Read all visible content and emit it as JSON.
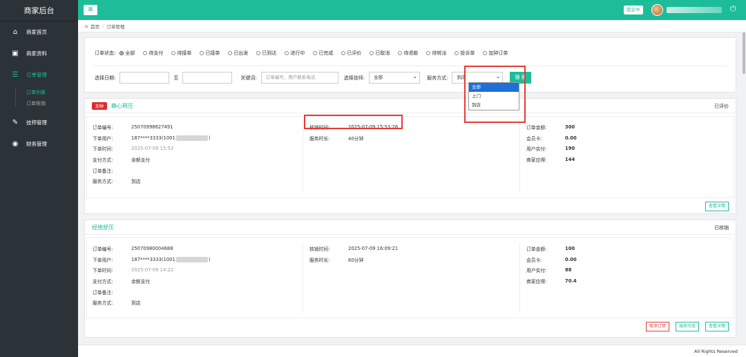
{
  "sidebar": {
    "title": "商家后台",
    "items": [
      {
        "label": "商家首页",
        "icon": "home-icon"
      },
      {
        "label": "商家资料",
        "icon": "profile-icon"
      },
      {
        "label": "订单管理",
        "icon": "order-icon"
      },
      {
        "label": "技师管理",
        "icon": "edit-icon"
      },
      {
        "label": "财务管理",
        "icon": "finance-icon"
      }
    ],
    "subitems": [
      "订单列表",
      "订单核销"
    ]
  },
  "topbar": {
    "menu_icon": "≡",
    "status_label": "营业中",
    "power_icon": "⏻"
  },
  "breadcrumb": {
    "home": "首页",
    "sep": "/",
    "current": "订单管理"
  },
  "filter": {
    "status_label": "订单状态:",
    "statuses": [
      "全部",
      "待支付",
      "待接单",
      "已接单",
      "已出发",
      "已到达",
      "进行中",
      "已完成",
      "已评价",
      "已取消",
      "待退款",
      "待转派",
      "投诉单",
      "加钟订单"
    ],
    "date_label": "选择日期:",
    "date_to": "至",
    "keyword_label": "关键词:",
    "keyword_placeholder": "订单编号、用户联系电话",
    "tech_label": "选择技师:",
    "tech_value": "全部",
    "service_label": "服务方式:",
    "service_value": "到店",
    "service_options": [
      "全部",
      "上门",
      "到店"
    ],
    "search_label": "搜 索"
  },
  "orders": [
    {
      "tag": "加钟",
      "title": "静心释压",
      "state": "已评价",
      "order_no_label": "订单编号:",
      "order_no": "25070998627491",
      "user_label": "下单用户:",
      "user_prefix": "187****3333(1001",
      "user_suffix": ")",
      "time_label": "下单时间:",
      "time": "2025-07-09 15:53",
      "pay_label": "支付方式:",
      "pay": "余额支付",
      "note_label": "订单备注:",
      "service_label": "服务方式:",
      "service": "到店",
      "verify_label": "核销时间:",
      "verify": "2025-07-09 15:53:26",
      "duration_label": "服务时长:",
      "duration": "40分钟",
      "amount_label": "订单金额:",
      "amount": "300",
      "card_label": "会员卡:",
      "card": "0.00",
      "paid_label": "用户实付:",
      "paid": "190",
      "merchant_label": "商家应得:",
      "merchant": "144",
      "buttons": [
        "查看详情"
      ]
    },
    {
      "title": "经络舒压",
      "state": "已核销",
      "order_no_label": "订单编号:",
      "order_no": "25070980004688",
      "user_label": "下单用户:",
      "user_prefix": "187****3333(1001",
      "user_suffix": ")",
      "time_label": "下单时间:",
      "time": "2025-07-09 14:22",
      "pay_label": "支付方式:",
      "pay": "余额支付",
      "note_label": "订单备注:",
      "service_label": "服务方式:",
      "service": "到店",
      "verify_label": "核销时间:",
      "verify": "2025-07-09 16:09:21",
      "duration_label": "服务时长:",
      "duration": "60分钟",
      "amount_label": "订单金额:",
      "amount": "100",
      "card_label": "会员卡:",
      "card": "0.00",
      "paid_label": "用户实付:",
      "paid": "88",
      "merchant_label": "商家应得:",
      "merchant": "70.4",
      "buttons": [
        "取消订单",
        "服务完成",
        "查看详情"
      ]
    }
  ],
  "footer": "All Rights Reserved"
}
